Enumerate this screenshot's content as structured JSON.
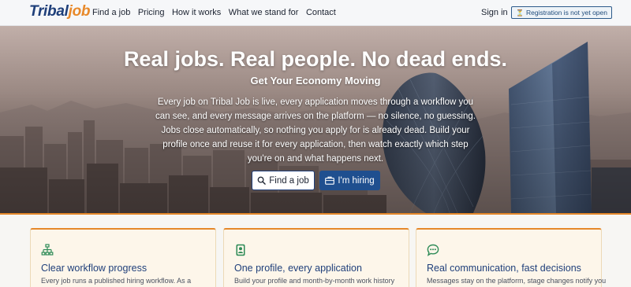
{
  "nav": {
    "logo_part1": "Tribal",
    "logo_part2": "job",
    "links": [
      "Find a job",
      "Pricing",
      "How it works",
      "What we stand for",
      "Contact"
    ],
    "signin": "Sign in",
    "registration_badge": "Registration is not yet open",
    "registration_icon": "hourglass-icon"
  },
  "hero": {
    "title": "Real jobs. Real people. No dead ends.",
    "subtitle": "Get Your Economy Moving",
    "body": "Every job on Tribal Job is live, every application moves through a workflow you can see, and every message arrives on the platform — no silence, no guessing. Jobs close automatically, so nothing you apply for is already dead. Build your profile once and reuse it for every application, then watch exactly which step you're on and what happens next.",
    "find_button": "Find a job",
    "find_icon": "search-icon",
    "hire_button": "I'm hiring",
    "hire_icon": "briefcase-icon"
  },
  "cards": [
    {
      "icon": "workflow-icon",
      "title": "Clear workflow progress",
      "text": "Every job runs a published hiring workflow. As a"
    },
    {
      "icon": "profile-card-icon",
      "title": "One profile, every application",
      "text": "Build your profile and month-by-month work history"
    },
    {
      "icon": "chat-icon",
      "title": "Real communication, fast decisions",
      "text": "Messages stay on the platform, stage changes notify you"
    }
  ],
  "colors": {
    "brand_blue": "#1f3f7a",
    "brand_orange": "#e8892a",
    "accent_green": "#2e8b57",
    "hire_button_bg": "#1f4f8f",
    "card_bg": "#fdf6ea"
  }
}
